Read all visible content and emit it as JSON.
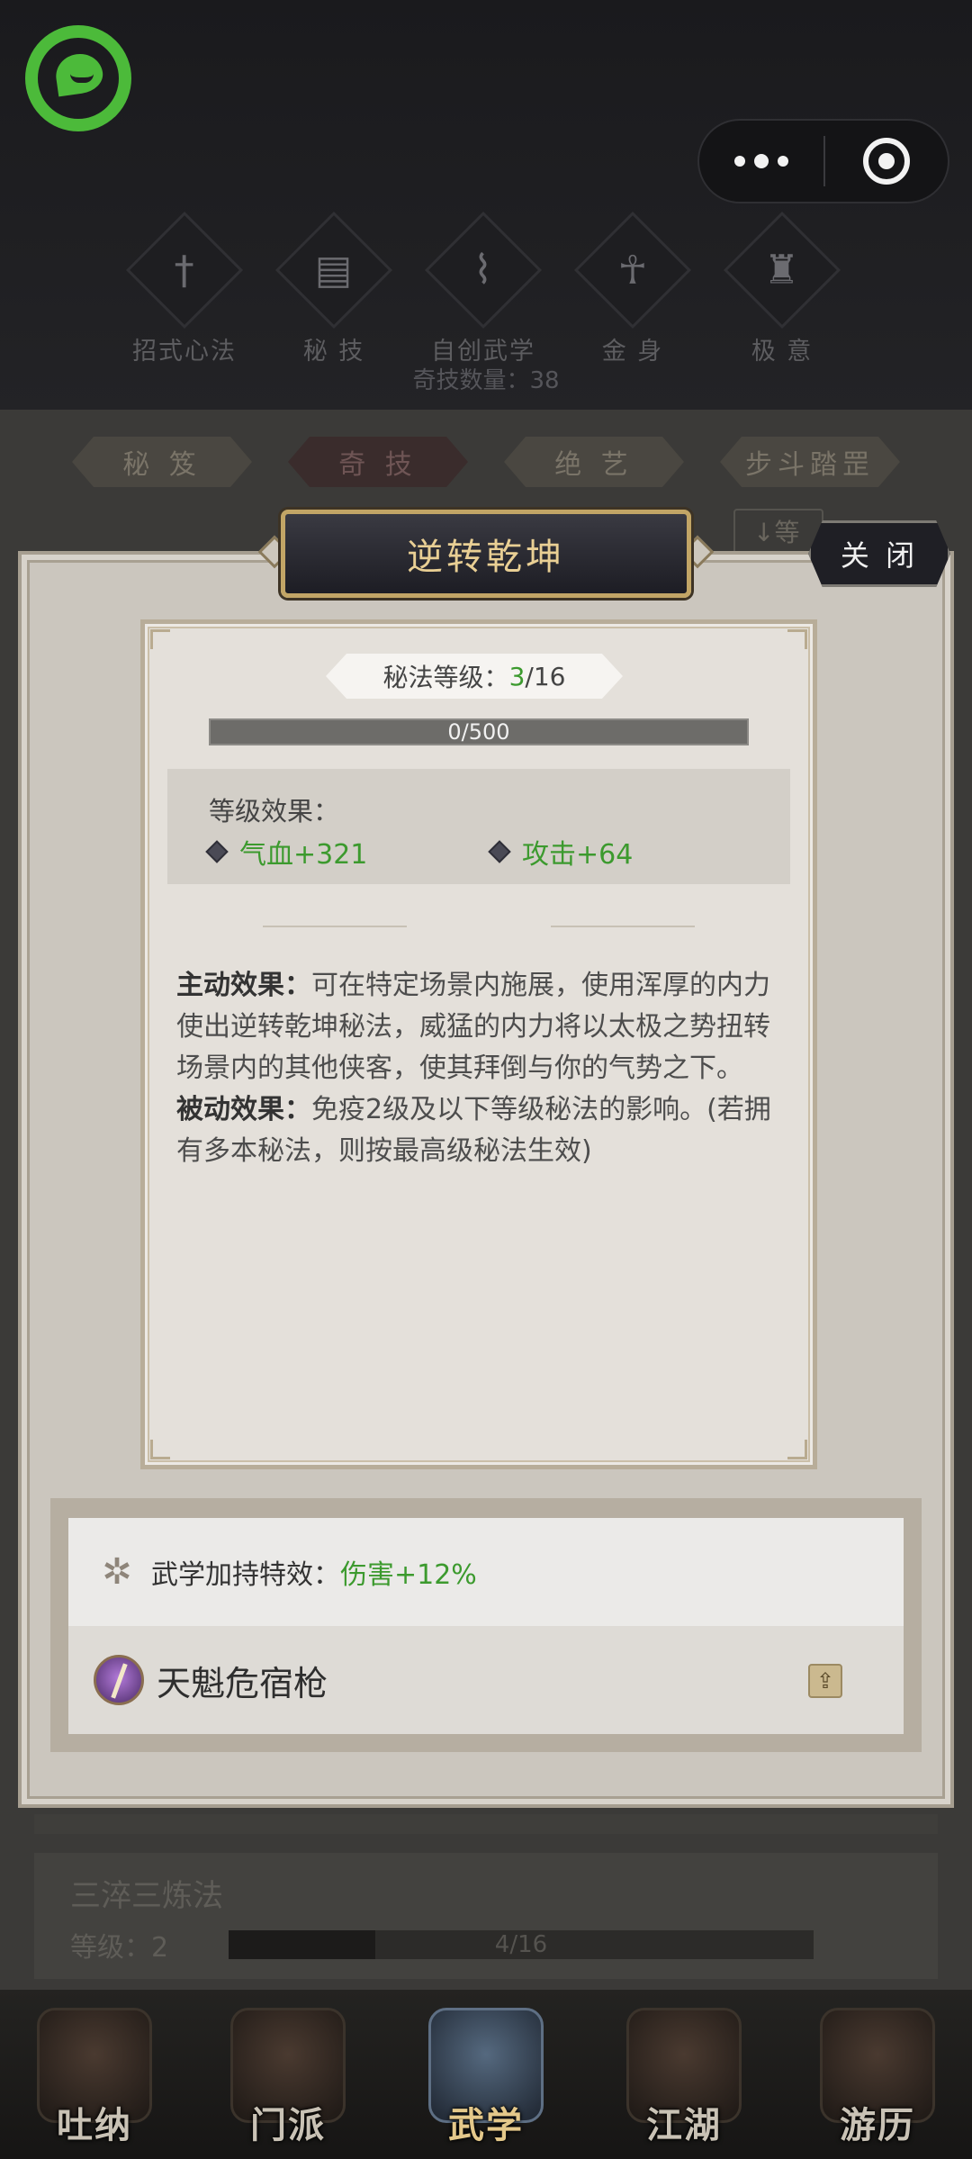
{
  "top_bar": {
    "logo_icon": "chat-bubble-icon",
    "capsule": {
      "more_icon": "more-dots-icon",
      "target_icon": "target-icon"
    }
  },
  "categories": [
    {
      "label": "招式心法",
      "icon": "sword-icon"
    },
    {
      "label": "秘 技",
      "icon": "book-icon"
    },
    {
      "label": "自创武学",
      "icon": "scroll-icon"
    },
    {
      "label": "金 身",
      "icon": "meditate-icon"
    },
    {
      "label": "极 意",
      "icon": "martial-stance-icon"
    }
  ],
  "skill_count": "奇技数量：38",
  "tabs": [
    "秘 笈",
    "奇 技",
    "绝 艺",
    "步斗踏罡"
  ],
  "active_tab": 1,
  "sort_button": "↓等",
  "modal": {
    "title": "逆转乾坤",
    "close_label": "关 闭",
    "level_label": "秘法等级：",
    "level_current": "3",
    "level_total": "/16",
    "exp_text": "0/500",
    "effect_header": "等级效果：",
    "effects": [
      "气血+321",
      "攻击+64"
    ],
    "active_label": "主动效果：",
    "active_text": "可在特定场景内施展，使用浑厚的内力使出逆转乾坤秘法，威猛的内力将以太极之势扭转场景内的其他侠客，使其拜倒与你的气势之下。",
    "passive_label": "被动效果：",
    "passive_text": "免疫2级及以下等级秘法的影响。(若拥有多本秘法，则按最高级秘法生效)",
    "bonus_label": "武学加持特效：",
    "bonus_value": "伤害+12%",
    "weapon_name": "天魁危宿枪",
    "share_icon": "share-icon"
  },
  "background_item": {
    "name": "三淬三炼法",
    "level_text": "等级：2",
    "progress_text": "4/16",
    "progress": 0.25
  },
  "bottom_nav": [
    {
      "label": "吐纳",
      "icon": "meditation-icon"
    },
    {
      "label": "门派",
      "icon": "sect-banner-icon"
    },
    {
      "label": "武学",
      "icon": "scripture-icon",
      "active": true
    },
    {
      "label": "江湖",
      "icon": "straw-hat-icon"
    },
    {
      "label": "游历",
      "icon": "horse-icon"
    }
  ]
}
